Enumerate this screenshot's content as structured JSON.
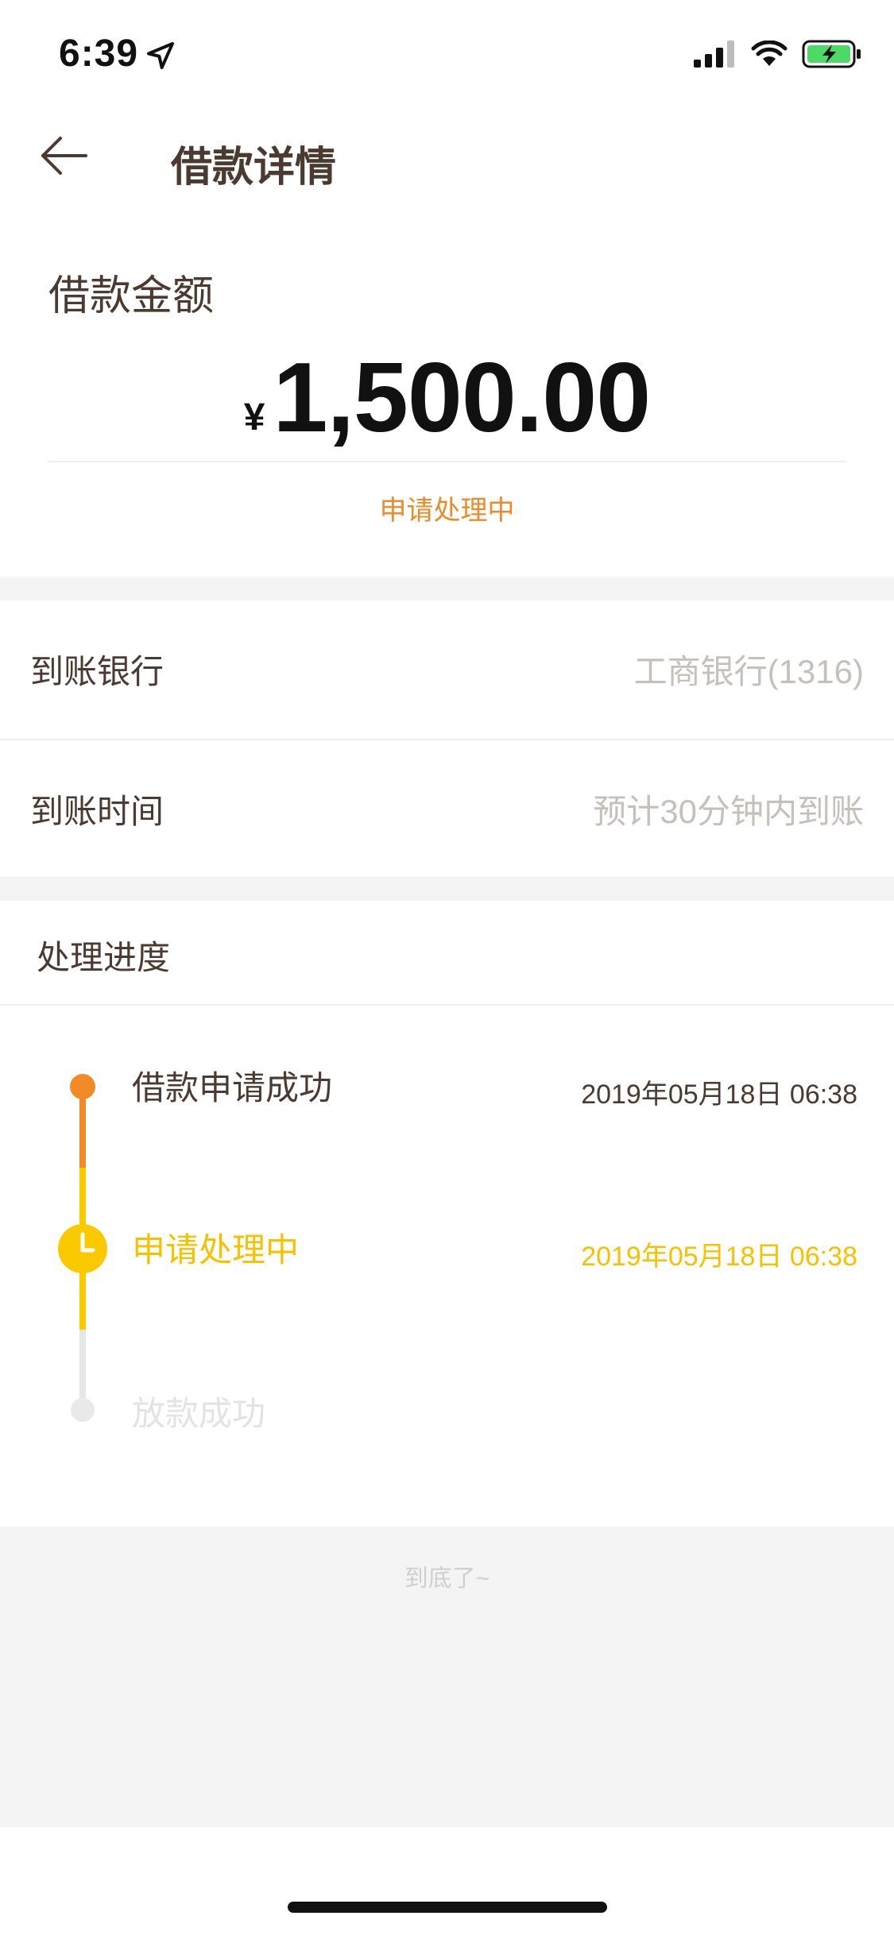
{
  "status_bar": {
    "time": "6:39"
  },
  "header": {
    "title": "借款详情"
  },
  "amount_card": {
    "label": "借款金额",
    "currency": "¥",
    "amount": "1,500.00",
    "status": "申请处理中"
  },
  "info_rows": [
    {
      "label": "到账银行",
      "value": "工商银行(1316)"
    },
    {
      "label": "到账时间",
      "value": "预计30分钟内到账"
    }
  ],
  "progress": {
    "title": "处理进度",
    "steps": [
      {
        "title": "借款申请成功",
        "time": "2019年05月18日 06:38"
      },
      {
        "title": "申请处理中",
        "time": "2019年05月18日 06:38"
      },
      {
        "title": "放款成功",
        "time": ""
      }
    ]
  },
  "footer": {
    "text": "到底了~"
  },
  "colors": {
    "done": "#f28b25",
    "current": "#fbc900",
    "pending": "#e6e6e6",
    "pending_text": "#e3e3e3"
  }
}
